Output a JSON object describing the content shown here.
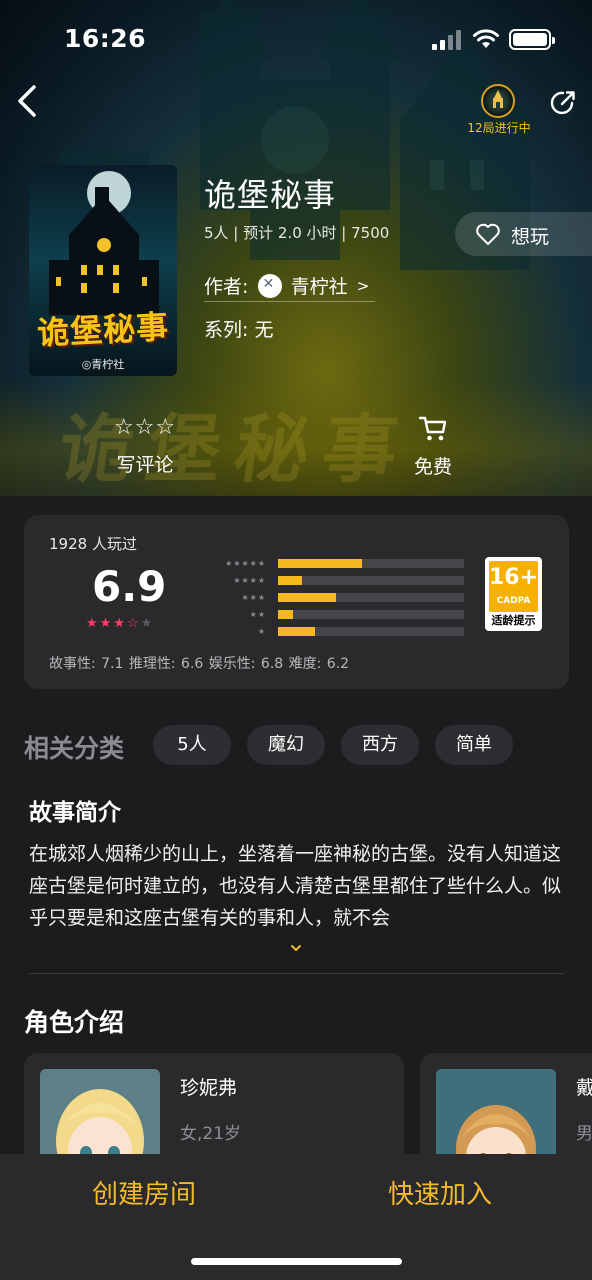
{
  "status_bar": {
    "time": "16:26"
  },
  "nav": {
    "games_in_progress": "12局进行中"
  },
  "game": {
    "title": "诡堡秘事",
    "meta": "5人 | 预计 2.0 小时 | 7500",
    "want_label": "想玩",
    "author_label": "作者:",
    "author_name": "青柠社",
    "author_chevron": ">",
    "series": "系列: 无",
    "cover_title": "诡堡秘事",
    "cover_publisher": "◎青柠社",
    "hero_watermark": "诡堡秘事"
  },
  "actions": {
    "review_label": "写评论",
    "free_label": "免费"
  },
  "rating": {
    "played": "1928 人玩过",
    "score": "6.9",
    "score_stars": 3.5,
    "distribution": [
      0.45,
      0.13,
      0.31,
      0.08,
      0.2
    ],
    "age_badge": {
      "age": "16+",
      "org": "CADPA",
      "tip": "适龄提示"
    },
    "dimensions": "故事性: 7.1  推理性: 6.6  娱乐性: 6.8  难度: 6.2"
  },
  "tags": {
    "title": "相关分类",
    "items": [
      "5人",
      "魔幻",
      "西方",
      "简单"
    ]
  },
  "synopsis": {
    "title": "故事简介",
    "body": "在城郊人烟稀少的山上，坐落着一座神秘的古堡。没有人知道这座古堡是何时建立的，也没有人清楚古堡里都住了些什么人。似乎只要是和这座古堡有关的事和人，就不会"
  },
  "characters": {
    "title": "角色介绍",
    "items": [
      {
        "name": "珍妮弗",
        "info": "女,21岁"
      },
      {
        "name": "戴",
        "info": "男"
      }
    ]
  },
  "bottom_bar": {
    "create_room": "创建房间",
    "quick_join": "快速加入"
  },
  "colors": {
    "accent": "#f3bb28",
    "star": "#ff3d64",
    "bar": "#f5b81e",
    "card": "#2a2a2d"
  }
}
